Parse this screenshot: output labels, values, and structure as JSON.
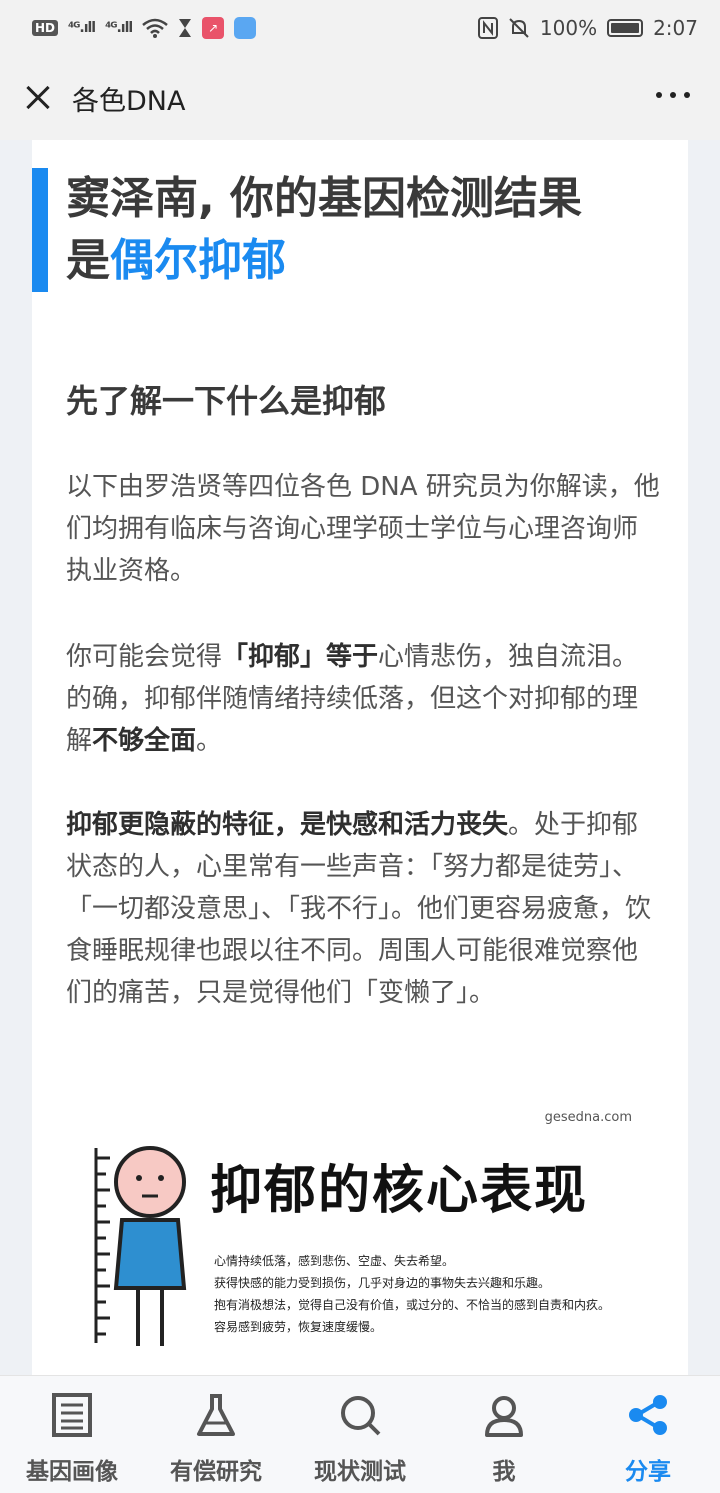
{
  "status_bar": {
    "hd": "HD",
    "sig1": "⁴ᴳ.ıll",
    "sig2": "⁴ᴳ.ıll",
    "battery_pct": "100%",
    "time": "2:07"
  },
  "nav": {
    "title": "各色DNA"
  },
  "article": {
    "headline_line1": "窦泽南, 你的基因检测结果",
    "headline_prefix": "是",
    "headline_highlight": "偶尔抑郁",
    "section_heading": "先了解一下什么是抑郁",
    "p1": "以下由罗浩贤等四位各色 DNA 研究员为你解读，他们均拥有临床与咨询心理学硕士学位与心理咨询师执业资格。",
    "p2_a": "你可能会觉得",
    "p2_b": "「抑郁」等于",
    "p2_c": "心情悲伤，独自流泪。的确，抑郁伴随情绪持续低落，但这个对抑郁的理解",
    "p2_d": "不够全面",
    "p2_e": "。",
    "p3_a": "抑郁更隐蔽的特征，是快感和活力丧失",
    "p3_b": "。处于抑郁状态的人，心里常有一些声音：「努力都是徒劳」、「一切都没意思」、「我不行」。他们更容易疲惫，饮食睡眠规律也跟以往不同。周围人可能很难觉察他们的痛苦，只是觉得他们「变懒了」。"
  },
  "infographic": {
    "source": "gesedna.com",
    "title": "抑郁的核心表现",
    "lines": [
      "心情持续低落，感到悲伤、空虚、失去希望。",
      "获得快感的能力受到损伤，几乎对身边的事物失去兴趣和乐趣。",
      "抱有消极想法，觉得自己没有价值，或过分的、不恰当的感到自责和内疚。",
      "容易感到疲劳，恢复速度缓慢。"
    ]
  },
  "tabs": [
    {
      "label": "基因画像",
      "icon": "document-icon"
    },
    {
      "label": "有偿研究",
      "icon": "flask-icon"
    },
    {
      "label": "现状测试",
      "icon": "search-icon"
    },
    {
      "label": "我",
      "icon": "person-icon"
    },
    {
      "label": "分享",
      "icon": "share-icon"
    }
  ],
  "colors": {
    "accent": "#1a8af0",
    "text": "#555555"
  }
}
